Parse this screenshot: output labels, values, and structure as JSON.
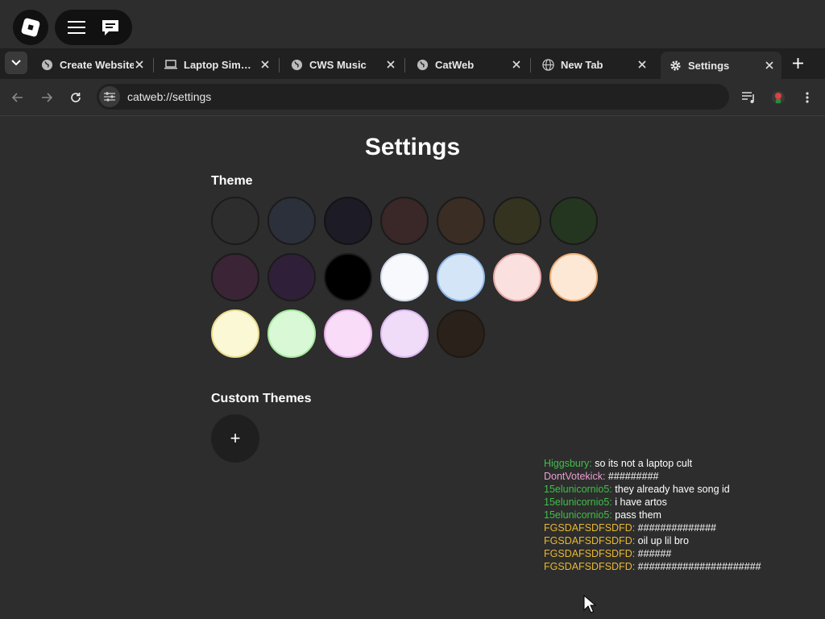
{
  "tabs": [
    {
      "label": "Create Website",
      "icon": "globe-icon"
    },
    {
      "label": "Laptop Sim…",
      "icon": "laptop-icon"
    },
    {
      "label": "CWS Music",
      "icon": "globe-icon"
    },
    {
      "label": "CatWeb",
      "icon": "globe-icon"
    },
    {
      "label": "New Tab",
      "icon": "globe-icon"
    },
    {
      "label": "Settings",
      "icon": "gear-icon",
      "active": true
    }
  ],
  "address": {
    "url": "catweb://settings"
  },
  "page": {
    "title": "Settings",
    "theme_label": "Theme",
    "custom_themes_label": "Custom Themes",
    "add_symbol": "+"
  },
  "themes": [
    {
      "fill": "#2d2d2d",
      "border": "#1b1b1b"
    },
    {
      "fill": "#2c303b",
      "border": "#1b1b1b"
    },
    {
      "fill": "#1c1b26",
      "border": "#141414"
    },
    {
      "fill": "#3a2727",
      "border": "#1b1b1b"
    },
    {
      "fill": "#3a2d24",
      "border": "#1b1b1b"
    },
    {
      "fill": "#33331f",
      "border": "#1b1b1b"
    },
    {
      "fill": "#243620",
      "border": "#1b1b1b"
    },
    {
      "fill": "#3b2436",
      "border": "#1b1b1b"
    },
    {
      "fill": "#301f38",
      "border": "#1b1b1b"
    },
    {
      "fill": "#000000",
      "border": "#1b1b1b"
    },
    {
      "fill": "#f7f9fd",
      "border": "#d0d8e8"
    },
    {
      "fill": "#d4e5f8",
      "border": "#8fb8e8"
    },
    {
      "fill": "#fbe0e0",
      "border": "#e8a8a8"
    },
    {
      "fill": "#fde8d6",
      "border": "#f0b07a"
    },
    {
      "fill": "#fbf8d6",
      "border": "#e8dc8c"
    },
    {
      "fill": "#d8f8d6",
      "border": "#a8e8a0"
    },
    {
      "fill": "#f8dcf8",
      "border": "#e8b0e8"
    },
    {
      "fill": "#f0dcf8",
      "border": "#d8b8f0"
    },
    {
      "fill": "#2a211b",
      "border": "#1f1813"
    }
  ],
  "chat": [
    {
      "user": "Higgsbury:",
      "msg": "so its not a laptop cult",
      "color": "#3fbf4a"
    },
    {
      "user": "DontVotekick:",
      "msg": "#########",
      "color": "#e8a0d0"
    },
    {
      "user": "15elunicornio5:",
      "msg": "they already have song id",
      "color": "#3fbf4a"
    },
    {
      "user": "15elunicornio5:",
      "msg": "i have artos",
      "color": "#3fbf4a"
    },
    {
      "user": "15elunicornio5:",
      "msg": "pass them",
      "color": "#3fbf4a"
    },
    {
      "user": "FGSDAFSDFSDFD:",
      "msg": "##############",
      "color": "#e8b830"
    },
    {
      "user": "FGSDAFSDFSDFD:",
      "msg": "oil up lil bro",
      "color": "#e8b830"
    },
    {
      "user": "FGSDAFSDFSDFD:",
      "msg": "######",
      "color": "#e8b830"
    },
    {
      "user": "FGSDAFSDFSDFD:",
      "msg": "######################",
      "color": "#e8b830"
    }
  ]
}
